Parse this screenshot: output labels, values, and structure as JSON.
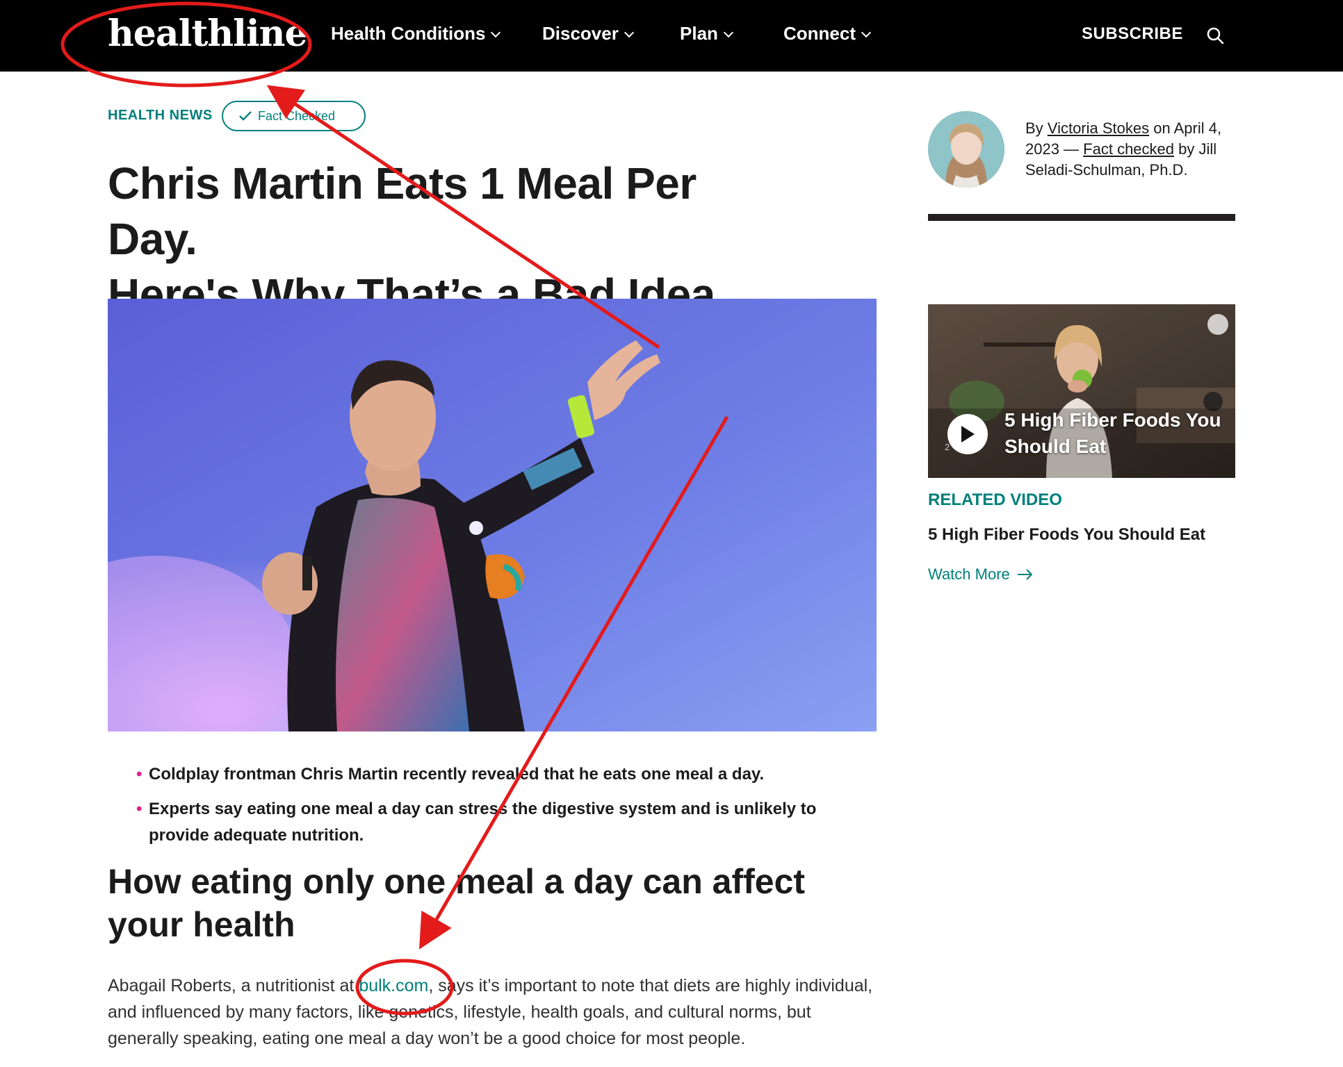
{
  "nav": {
    "logo": "healthline",
    "items": [
      {
        "label": "Health Conditions"
      },
      {
        "label": "Discover"
      },
      {
        "label": "Plan"
      },
      {
        "label": "Connect"
      }
    ],
    "subscribe": "SUBSCRIBE"
  },
  "article": {
    "kicker": "HEALTH NEWS",
    "fact_checked": "Fact Checked",
    "headline_line1": "Chris Martin Eats 1 Meal Per Day.",
    "headline_line2": "Here's Why That’s a Bad Idea",
    "bullets": [
      "Coldplay frontman Chris Martin recently revealed that he eats one meal a day.",
      "Experts say eating one meal a day can stress the digestive system and is unlikely to provide adequate nutrition."
    ],
    "subhead": "How eating only one meal a day can affect your health",
    "para_before": "Abagail Roberts, a nutritionist at ",
    "para_link": "bulk.com",
    "para_after": ", says it’s important to note that diets are highly individual, and influenced by many factors, like genetics, lifestyle, health goals, and cultural norms, but generally speaking, eating one meal a day won’t be a good choice for most people."
  },
  "byline": {
    "by": "By ",
    "author": "Victoria Stokes",
    "on_date": " on April 4, 2023 — ",
    "fact_link": "Fact checked",
    "by2": " by Jill Seladi-Schulman, Ph.D."
  },
  "sidebar": {
    "video_overlay_title": "5 High Fiber Foods You Should Eat",
    "video_small_text": "2",
    "related_label": "RELATED VIDEO",
    "related_title": "5 High Fiber Foods You Should Eat",
    "watch_more": "Watch More"
  },
  "colors": {
    "brand_teal": "#00807a",
    "bullet_pink": "#e0218a",
    "nav_bg": "#000000",
    "annotation_red": "#e31b1b"
  }
}
